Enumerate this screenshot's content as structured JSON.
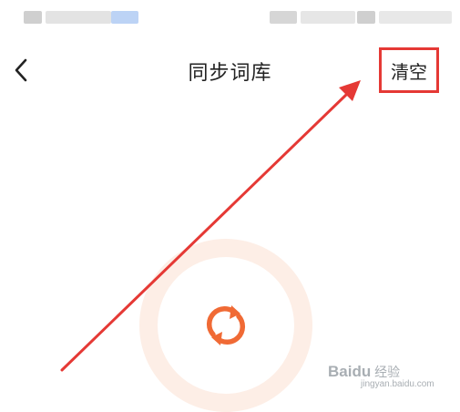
{
  "header": {
    "title": "同步词库",
    "clear_label": "清空",
    "back_icon": "chevron-left-icon"
  },
  "sync": {
    "icon": "sync-icon",
    "accent_color": "#f06a35"
  },
  "annotation": {
    "highlight_color": "#e53935"
  },
  "watermark": {
    "brand": "Baidu",
    "suffix": "经验",
    "url": "jingyan.baidu.com"
  }
}
